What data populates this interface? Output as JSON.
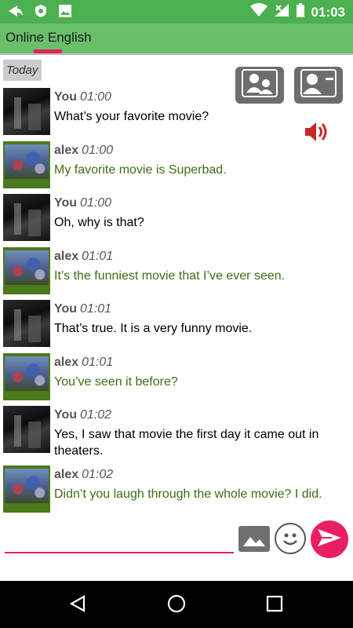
{
  "status_bar": {
    "time": "01:03",
    "left_icons": [
      "share-arrow-icon",
      "shield-icon",
      "image-icon"
    ],
    "right_icons": [
      "wifi-icon",
      "signal-icon",
      "battery-icon"
    ]
  },
  "header": {
    "title": "Online English",
    "accent": "#e91e63"
  },
  "chat": {
    "date_label": "Today",
    "messages": [
      {
        "sender": "You",
        "time": "01:00",
        "text": "What’s your favorite movie?"
      },
      {
        "sender": "alex",
        "time": "01:00",
        "text": "My favorite movie is Superbad."
      },
      {
        "sender": "You",
        "time": "01:00",
        "text": "Oh, why is that?"
      },
      {
        "sender": "alex",
        "time": "01:01",
        "text": "It’s the funniest movie that I’ve ever seen."
      },
      {
        "sender": "You",
        "time": "01:01",
        "text": "That’s true. It is a very funny movie."
      },
      {
        "sender": "alex",
        "time": "01:01",
        "text": "You’ve seen it before?"
      },
      {
        "sender": "You",
        "time": "01:02",
        "text": "Yes, I saw that movie the first day it came out in theaters."
      },
      {
        "sender": "alex",
        "time": "01:02",
        "text": "Didn’t you laugh through the whole movie? I did."
      }
    ]
  },
  "toolbar": {
    "icons": [
      "contacts-icon",
      "remove-contact-icon",
      "speaker-icon"
    ]
  },
  "composer": {
    "value": "",
    "icons": [
      "gallery-icon",
      "emoji-icon",
      "send-icon"
    ]
  },
  "nav": {
    "icons": [
      "back-icon",
      "home-icon",
      "recents-icon"
    ]
  },
  "colors": {
    "status_bar": "#4caf50",
    "title_bar": "#6abf69",
    "you_text": "#000000",
    "alex_text": "#3c6e12",
    "send_button": "#e91e63"
  }
}
